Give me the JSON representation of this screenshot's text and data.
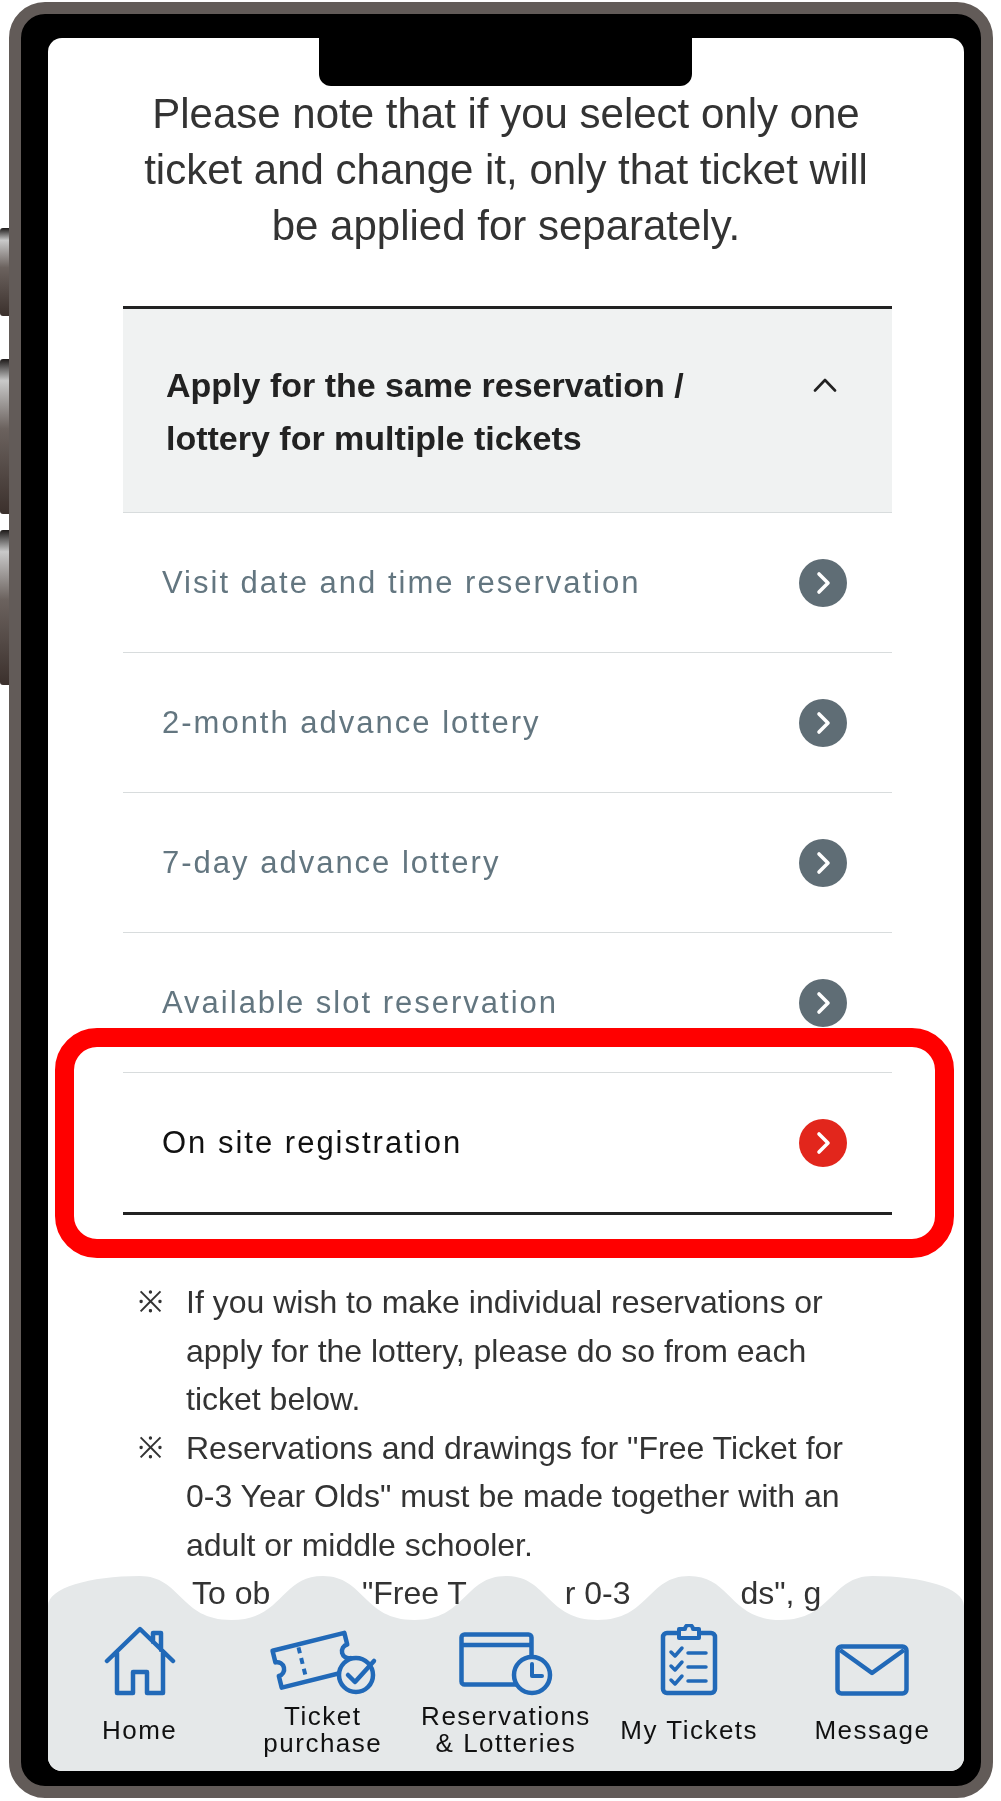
{
  "notice": "Please note that if you select only one ticket and change it, only that ticket will be applied for separately.",
  "accordion": {
    "title": "Apply for the same reservation / lottery for multiple tickets",
    "expanded": true,
    "items": [
      {
        "label": "Visit date and time reservation",
        "highlighted": false
      },
      {
        "label": "2-month advance lottery",
        "highlighted": false
      },
      {
        "label": "7-day advance lottery",
        "highlighted": false
      },
      {
        "label": "Available slot reservation",
        "highlighted": false
      },
      {
        "label": "On site registration",
        "highlighted": true
      }
    ]
  },
  "notes": [
    {
      "mark": "※",
      "text": "If you wish to make individual reservations or apply for the lottery, please do so from each ticket below."
    },
    {
      "mark": "※",
      "text": "Reservations and drawings for \"Free Ticket for 0-3 Year Olds\" must be made together with an adult or middle schooler."
    }
  ],
  "covered_line_fragments": [
    "To ob",
    "\"Free T",
    "r 0-3",
    "ds\", g"
  ],
  "bottom_nav": [
    {
      "kind": "home",
      "label": "Home"
    },
    {
      "kind": "ticket",
      "label": "Ticket purchase"
    },
    {
      "kind": "reservations",
      "label": "Reservations & Lotteries"
    },
    {
      "kind": "my_tickets",
      "label": "My Tickets"
    },
    {
      "kind": "message",
      "label": "Message"
    }
  ]
}
